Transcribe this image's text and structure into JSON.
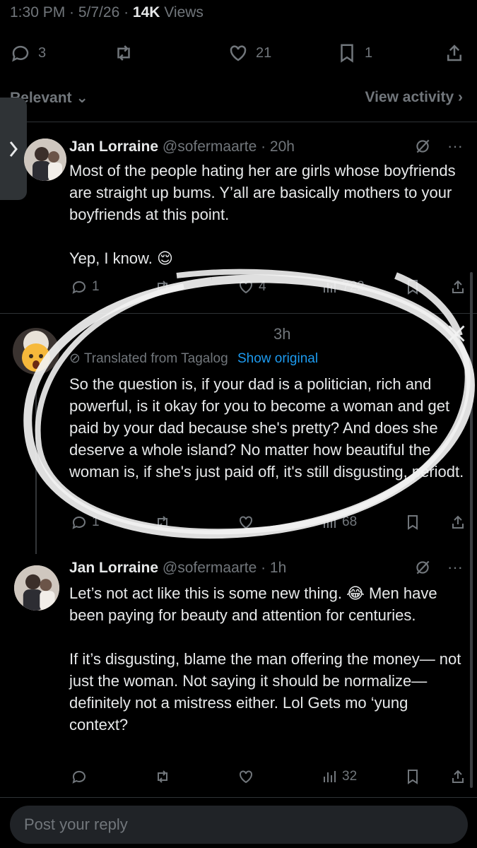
{
  "post_meta": {
    "time": "1:30 PM · 5/7/26 · ",
    "views_count": "14K",
    "views_label": " Views"
  },
  "actions": {
    "replies": "3",
    "retweets": "",
    "likes": "21",
    "bookmarks": "1"
  },
  "sort": {
    "label": "Relevant",
    "view_activity": "View activity"
  },
  "tweets": [
    {
      "name": "Jan Lorraine",
      "handle": "@sofermaarte",
      "time": "· 20h",
      "text_1": "Most of the people hating her are girls whose boyfriends are straight up bums. Y’all are basically mothers to your boyfriends at this point.",
      "text_2": "Yep, I know. 😌",
      "replies": "1",
      "likes": "4",
      "views": "722"
    },
    {
      "time": "3h",
      "translated_label": "Translated from Tagalog",
      "show_original": "Show original",
      "text_1": "So the question is, if your dad is a politician, rich and powerful, is it okay for you to become a woman and get paid by your dad because she's pretty? And does she deserve a whole island? No matter how beautiful the woman is, if she's just paid off, it's still disgusting, periodt.",
      "replies": "1",
      "views": "68"
    },
    {
      "name": "Jan Lorraine",
      "handle": "@sofermaarte",
      "time": "· 1h",
      "text_1": "Let’s not act like this is some new thing. 😂 Men have been paying for beauty and attention for centuries.",
      "text_2": "If it’s disgusting, blame the man offering the money— not just the woman. Not saying it should be normalize—definitely not a mistress either. Lol Gets mo ‘yung context?",
      "views": "32"
    }
  ],
  "reply_box": {
    "placeholder": "Post your reply"
  }
}
